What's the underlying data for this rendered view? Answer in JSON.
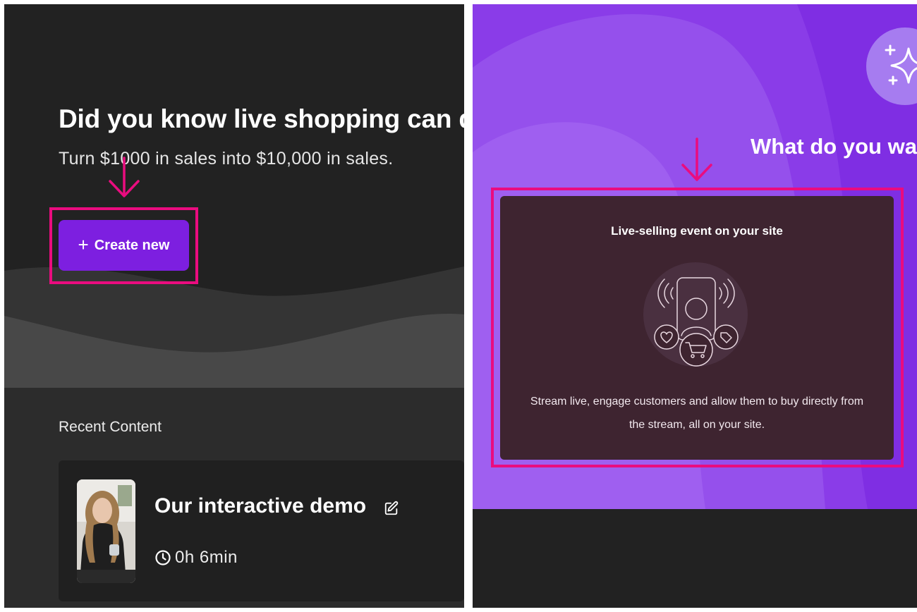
{
  "left_panel": {
    "hero": {
      "title": "Did you know live shopping can d",
      "subtitle": "Turn $1000 in sales into $10,000 in sales."
    },
    "create_button": {
      "icon": "plus-icon",
      "label": "Create new"
    },
    "recent": {
      "heading": "Recent Content",
      "items": [
        {
          "title": "Our interactive demo",
          "duration": "0h 6min",
          "edit_icon": "edit-icon",
          "duration_icon": "clock-icon"
        }
      ]
    }
  },
  "right_panel": {
    "badge_icon": "sparkle-icon",
    "modal_title": "What do you wa",
    "option": {
      "title": "Live-selling event on your site",
      "illustration": "live-stream-phone-icon",
      "description": "Stream live, engage customers and allow them to buy directly from the stream, all on your site."
    }
  },
  "colors": {
    "accent_purple": "#7d1fe0",
    "highlight_pink": "#ea0c7f",
    "right_bg_purple": "#8a3ce8",
    "dark_bg": "#222222",
    "option_card_bg": "#3e2430"
  }
}
